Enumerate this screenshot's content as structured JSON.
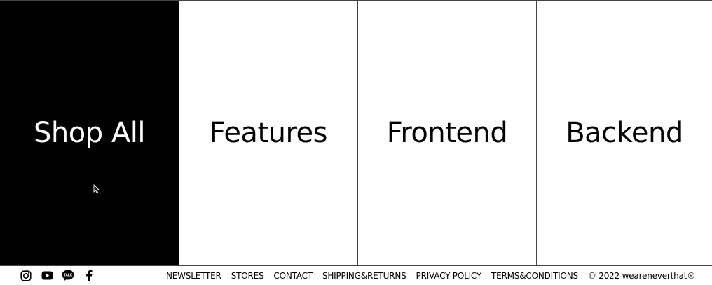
{
  "panels": [
    {
      "label": "Shop All",
      "active": true
    },
    {
      "label": "Features",
      "active": false
    },
    {
      "label": "Frontend",
      "active": false
    },
    {
      "label": "Backend",
      "active": false
    }
  ],
  "footer": {
    "social": [
      {
        "icon": "instagram-icon"
      },
      {
        "icon": "youtube-icon"
      },
      {
        "icon": "kakaotalk-icon",
        "text": "TALK"
      },
      {
        "icon": "facebook-icon"
      }
    ],
    "links": [
      "NEWSLETTER",
      "STORES",
      "CONTACT",
      "SHIPPING&RETURNS",
      "PRIVACY POLICY",
      "TERMS&CONDITIONS"
    ],
    "copyright": "© 2022 weareneverthat®"
  }
}
